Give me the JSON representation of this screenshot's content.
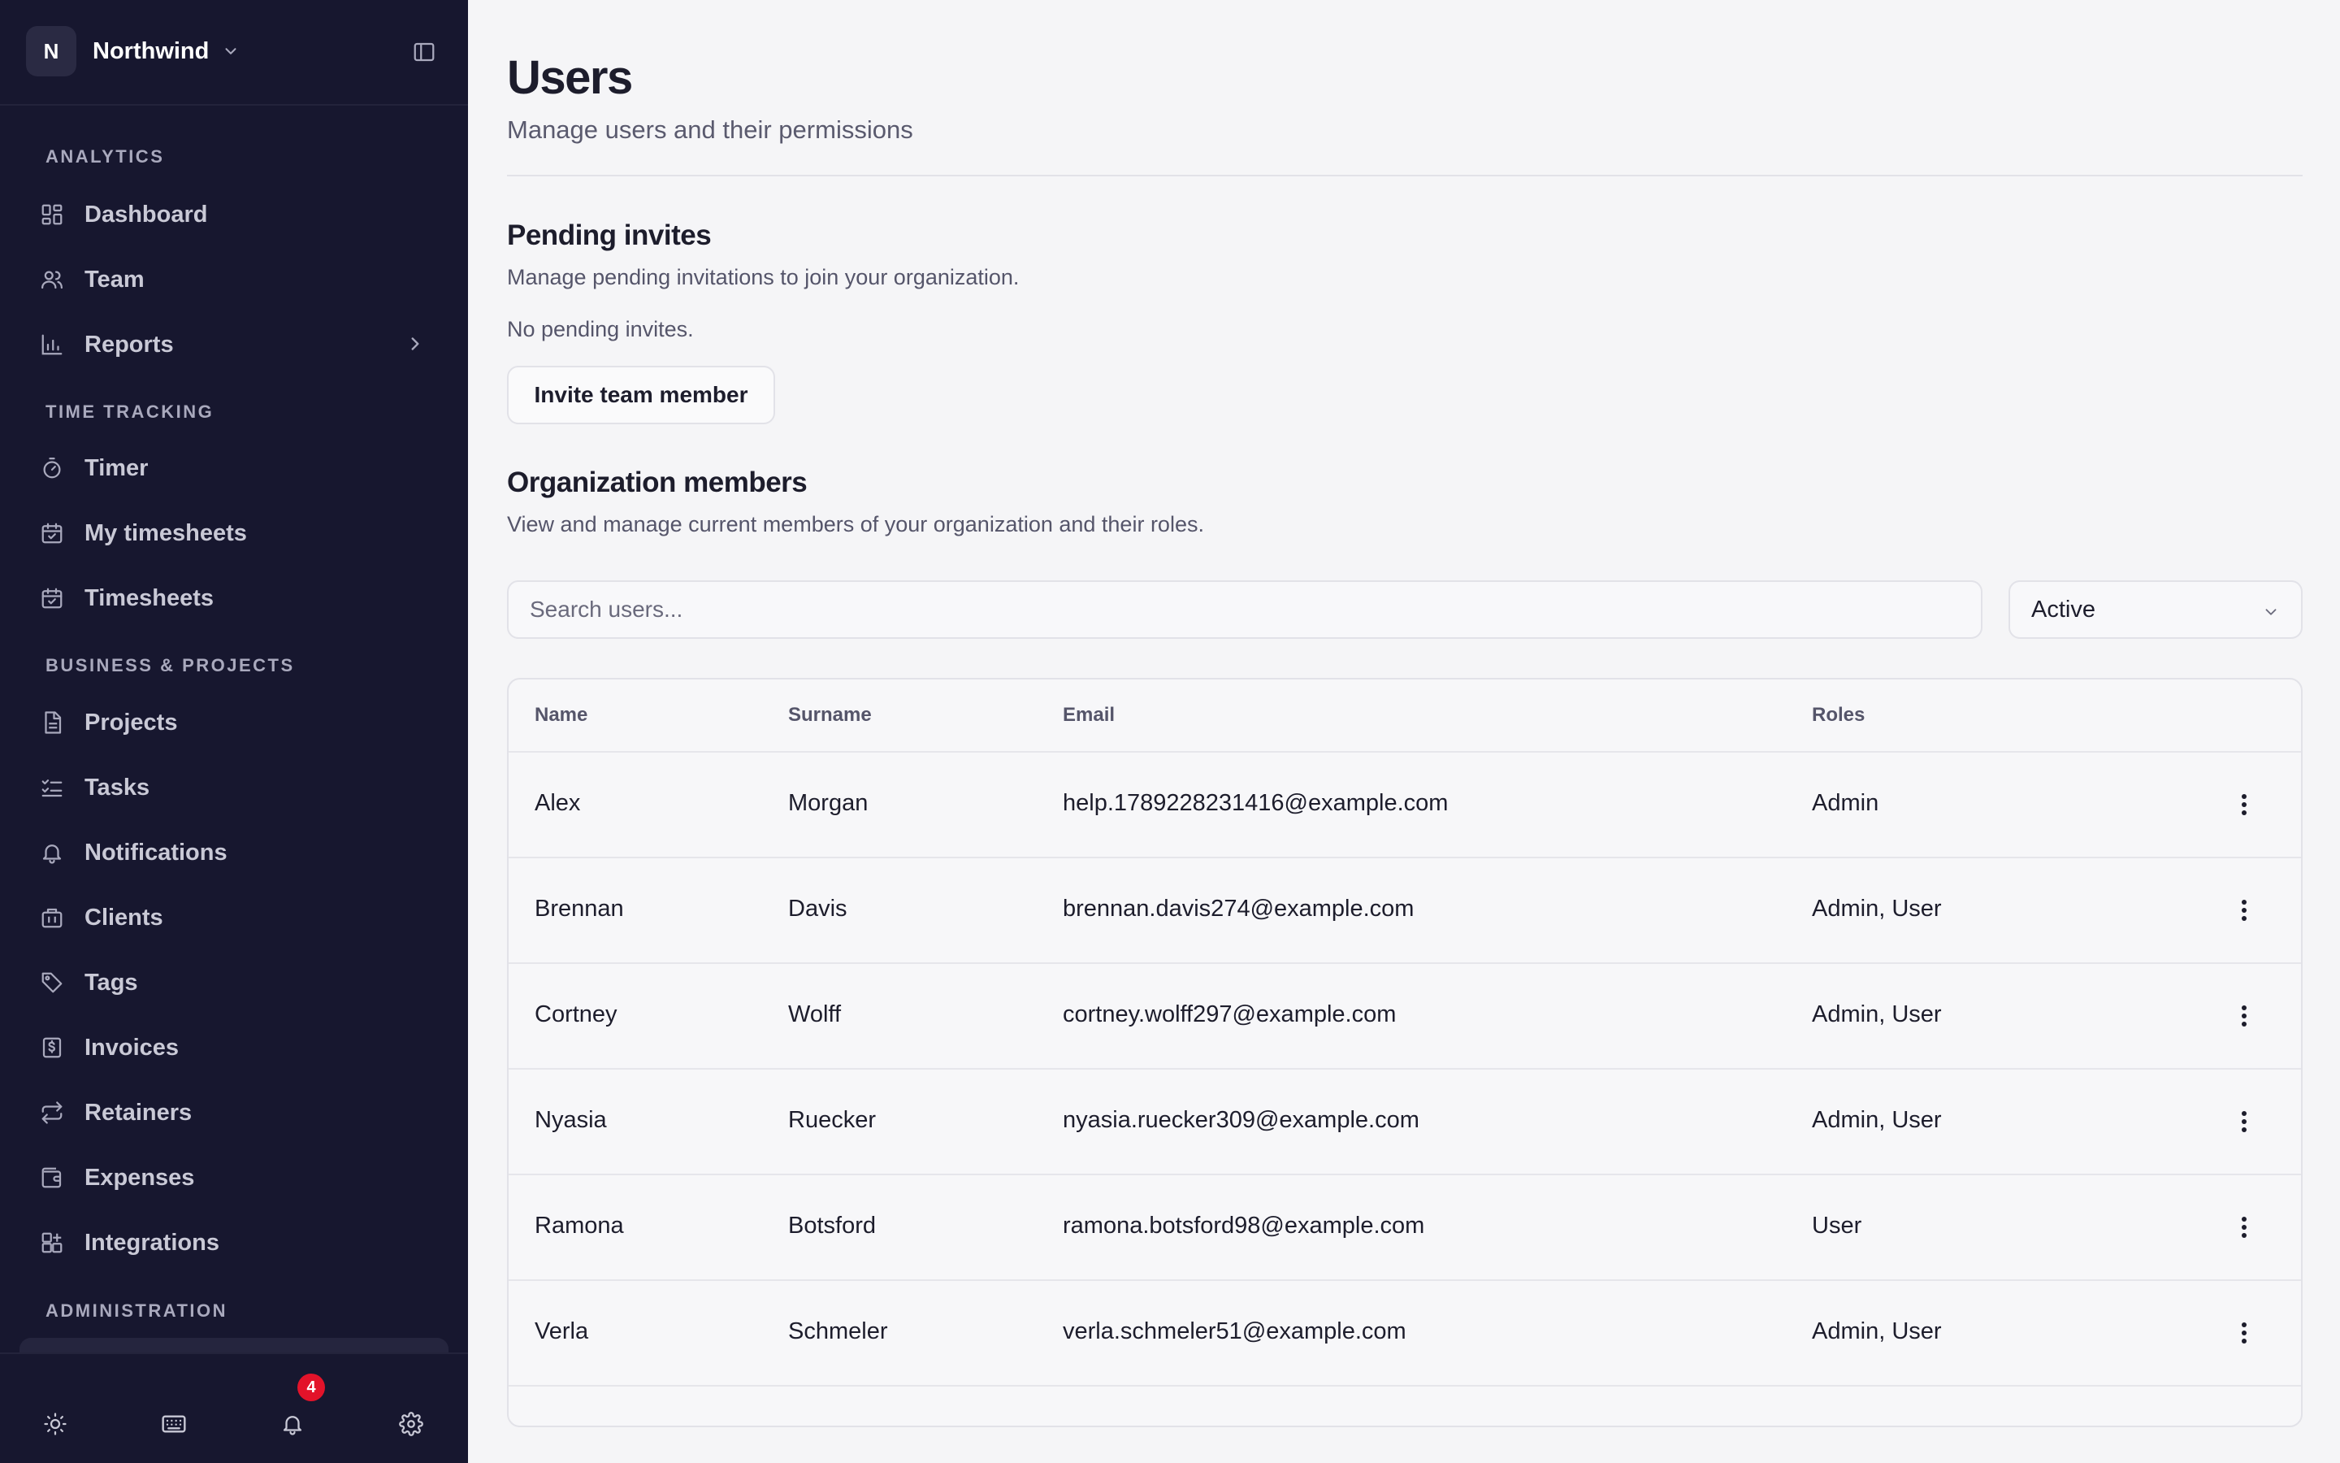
{
  "org": {
    "initial": "N",
    "name": "Northwind"
  },
  "sidebar": {
    "sections": [
      {
        "label": "ANALYTICS"
      },
      {
        "label": "TIME TRACKING"
      },
      {
        "label": "BUSINESS & PROJECTS"
      },
      {
        "label": "ADMINISTRATION"
      }
    ],
    "items": [
      {
        "label": "Dashboard",
        "icon": "dashboard-icon"
      },
      {
        "label": "Team",
        "icon": "team-icon"
      },
      {
        "label": "Reports",
        "icon": "bar-chart-icon"
      },
      {
        "label": "Timer",
        "icon": "stopwatch-icon"
      },
      {
        "label": "My timesheets",
        "icon": "calendar-check-icon"
      },
      {
        "label": "Timesheets",
        "icon": "calendar-check-icon"
      },
      {
        "label": "Projects",
        "icon": "document-icon"
      },
      {
        "label": "Tasks",
        "icon": "checklist-icon"
      },
      {
        "label": "Notifications",
        "icon": "bell-icon"
      },
      {
        "label": "Clients",
        "icon": "building-icon"
      },
      {
        "label": "Tags",
        "icon": "tag-icon"
      },
      {
        "label": "Invoices",
        "icon": "invoice-icon"
      },
      {
        "label": "Retainers",
        "icon": "repeat-icon"
      },
      {
        "label": "Expenses",
        "icon": "wallet-icon"
      },
      {
        "label": "Integrations",
        "icon": "puzzle-icon"
      }
    ],
    "footer": {
      "notification_count": "4"
    }
  },
  "page": {
    "title": "Users",
    "subtitle": "Manage users and their permissions"
  },
  "pending": {
    "title": "Pending invites",
    "description": "Manage pending invitations to join your organization.",
    "empty_text": "No pending invites.",
    "invite_button": "Invite team member"
  },
  "members": {
    "title": "Organization members",
    "description": "View and manage current members of your organization and their roles.",
    "search_placeholder": "Search users...",
    "status_filter": "Active",
    "columns": {
      "name": "Name",
      "surname": "Surname",
      "email": "Email",
      "roles": "Roles"
    },
    "rows": [
      {
        "name": "Alex",
        "surname": "Morgan",
        "email": "help.1789228231416@example.com",
        "roles": "Admin"
      },
      {
        "name": "Brennan",
        "surname": "Davis",
        "email": "brennan.davis274@example.com",
        "roles": "Admin, User"
      },
      {
        "name": "Cortney",
        "surname": "Wolff",
        "email": "cortney.wolff297@example.com",
        "roles": "Admin, User"
      },
      {
        "name": "Nyasia",
        "surname": "Ruecker",
        "email": "nyasia.ruecker309@example.com",
        "roles": "Admin, User"
      },
      {
        "name": "Ramona",
        "surname": "Botsford",
        "email": "ramona.botsford98@example.com",
        "roles": "User"
      },
      {
        "name": "Verla",
        "surname": "Schmeler",
        "email": "verla.schmeler51@example.com",
        "roles": "Admin, User"
      }
    ]
  },
  "colors": {
    "sidebar_bg": "#17172f",
    "main_bg": "#f5f5f7",
    "badge": "#e3132a"
  }
}
